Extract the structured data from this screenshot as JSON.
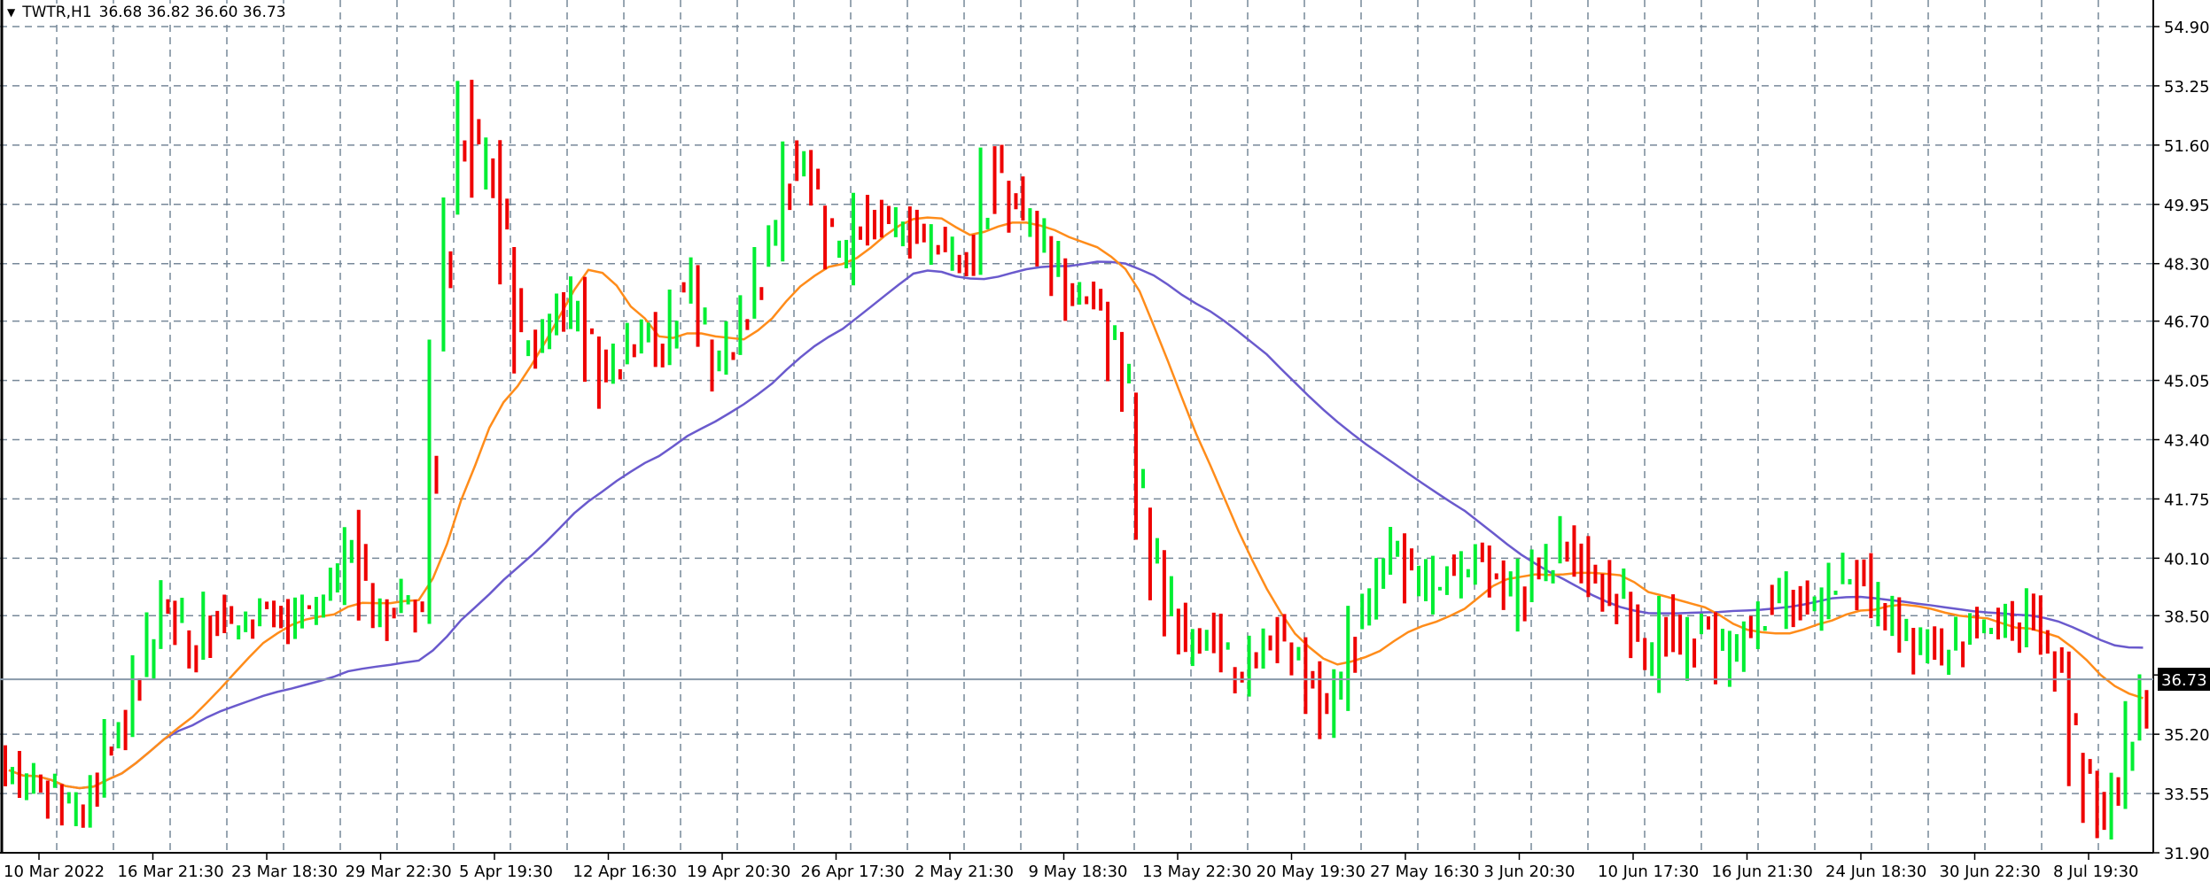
{
  "header": {
    "symbol": "TWTR,H1",
    "ohlc": "36.68 36.82 36.60 36.73",
    "collapse_icon": "triangle-down-icon"
  },
  "colors": {
    "bull": "#00ee33",
    "bear": "#ee0000",
    "ma_fast": "#ff8c1a",
    "ma_slow": "#6a5acd",
    "grid": "#778899"
  },
  "chart_data": {
    "type": "ohlc",
    "title": "TWTR,H1",
    "ylim": [
      31.9,
      54.9
    ],
    "y_ticks": [
      "54.90",
      "53.25",
      "51.60",
      "49.95",
      "48.30",
      "46.70",
      "45.05",
      "43.40",
      "41.75",
      "40.10",
      "38.50",
      "36.73",
      "35.20",
      "33.55",
      "31.90"
    ],
    "y_tick_values": [
      54.9,
      53.25,
      51.6,
      49.95,
      48.3,
      46.7,
      45.05,
      43.4,
      41.75,
      40.1,
      38.5,
      36.85,
      35.2,
      33.55,
      31.9
    ],
    "current_price": "36.73",
    "x_ticks": [
      "10 Mar 2022",
      "16 Mar 21:30",
      "23 Mar 18:30",
      "29 Mar 22:30",
      "5 Apr 19:30",
      "12 Apr 16:30",
      "19 Apr 20:30",
      "26 Apr 17:30",
      "2 May 21:30",
      "9 May 18:30",
      "13 May 22:30",
      "20 May 19:30",
      "27 May 16:30",
      "3 Jun 20:30",
      "10 Jun 17:30",
      "16 Jun 21:30",
      "24 Jun 18:30",
      "30 Jun 22:30",
      "8 Jul 19:30"
    ],
    "close": [
      34.2,
      33.9,
      34.0,
      33.6,
      33.1,
      33.4,
      34.0,
      35.3,
      35.5,
      37.0,
      38.0,
      38.8,
      38.0,
      37.5,
      38.7,
      38.5,
      38.3,
      38.5,
      38.8,
      38.5,
      38.3,
      38.8,
      39.0,
      39.5,
      40.6,
      38.8,
      38.6,
      38.5,
      39.0,
      38.8,
      46.0,
      50.0,
      53.0,
      50.5,
      51.5,
      48.0,
      46.0,
      46.0,
      46.5,
      47.0,
      47.5,
      45.5,
      45.0,
      45.8,
      46.0,
      46.5,
      45.5,
      47.5,
      47.5,
      46.0,
      45.5,
      46.5,
      47.0,
      48.5,
      49.0,
      51.5,
      51.0,
      50.0,
      48.5,
      48.5,
      49.5,
      49.5,
      49.5,
      49.8,
      49.2,
      49.0,
      48.7,
      48.6,
      48.4,
      51.0,
      50.3,
      49.8,
      49.5,
      48.5,
      48.0,
      47.5,
      47.5,
      47.3,
      45.5,
      44.5,
      41.0,
      39.5,
      38.5,
      37.5,
      37.5,
      38.0,
      37.0,
      36.5,
      37.5,
      38.0,
      37.5,
      37.5,
      36.5,
      35.7,
      36.5,
      38.5,
      39.0,
      40.0,
      40.3,
      39.5,
      39.5,
      39.5,
      39.5,
      39.8,
      40.3,
      39.5,
      38.8,
      39.3,
      39.8,
      39.8,
      40.5,
      40.0,
      39.5,
      39.2,
      39.0,
      37.5,
      37.0,
      38.3,
      37.5,
      38.0,
      38.5,
      37.3,
      37.5,
      38.0,
      38.7,
      38.8,
      39.0,
      38.8,
      38.7,
      39.6,
      39.5,
      39.3,
      38.8,
      38.5,
      38.0,
      37.5,
      37.8,
      37.5,
      38.0,
      38.3,
      38.3,
      38.0,
      38.0,
      39.0,
      37.5,
      37.0,
      34.5,
      33.3,
      32.8,
      33.8,
      35.5,
      36.73
    ],
    "ma_periods": [
      12,
      35
    ]
  }
}
